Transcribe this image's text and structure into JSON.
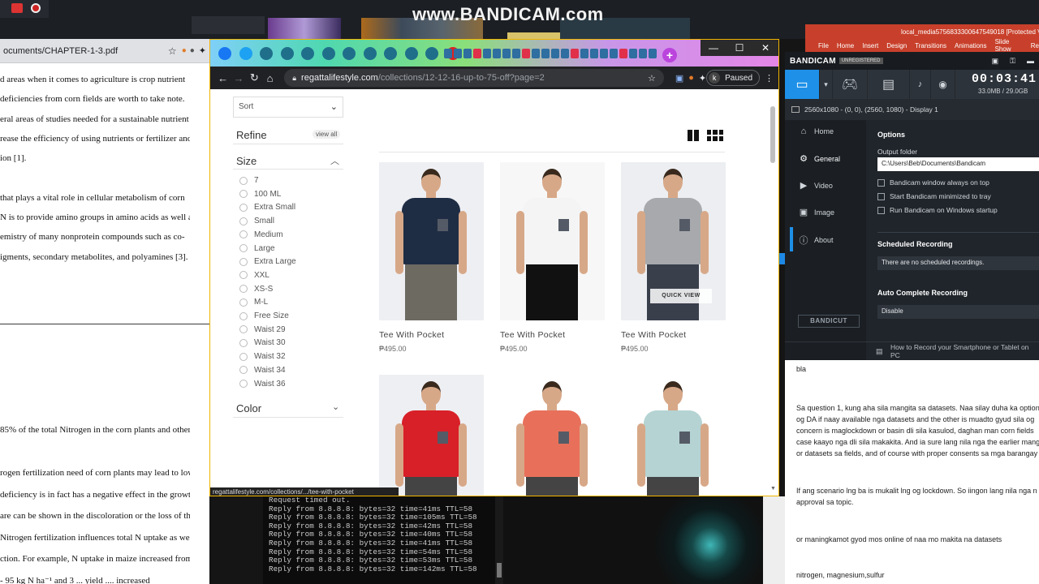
{
  "watermark": "www.BANDICAM.com",
  "pdf": {
    "tab_title": "ocuments/CHAPTER-1-3.pdf",
    "lines_top": [
      "d areas when it comes to agriculture is crop nutrient",
      "deficiencies from corn fields are worth to take note.",
      "eral areas of studies needed for a sustainable nutrient",
      "rease the efficiency of using nutrients or fertilizer and",
      "ion [1].",
      "",
      "that plays a vital role in cellular metabolism of corn",
      "N is to provide amino groups in amino acids as well as",
      "emistry of many nonprotein compounds such as co-",
      "igments, secondary metabolites, and polyamines [3]."
    ],
    "lines_bottom": [
      "85% of the total Nitrogen in the corn plants and other",
      "",
      "rogen fertilization need of corn plants may lead to low",
      "deficiency is in fact has a negative effect in the growth",
      "are can be shown in the discoloration or the loss of the",
      "Nitrogen fertilization influences total N uptake as well",
      "ction. For example, N uptake in maize increased from",
      "- 95 kg N ha⁻¹ and 3 ... yield .... increased"
    ]
  },
  "browser": {
    "url_domain": "regattalifestyle.com",
    "url_path": "/collections/12-12-16-up-to-75-off?page=2",
    "profile_initial": "k",
    "paused_label": "Paused",
    "status_url": "regattalifestyle.com/collections/.../tee-with-pocket",
    "window_controls": [
      "—",
      "☐",
      "✕"
    ]
  },
  "sidebar": {
    "sort_label": "Sort",
    "refine_label": "Refine",
    "view_all_label": "view all",
    "size_label": "Size",
    "size_options": [
      "7",
      "100 ML",
      "Extra Small",
      "Small",
      "Medium",
      "Large",
      "Extra Large",
      "XXL",
      "XS-S",
      "M-L",
      "Free Size",
      "Waist 29",
      "Waist 30",
      "Waist 32",
      "Waist 34",
      "Waist 36"
    ],
    "color_label": "Color"
  },
  "products": [
    {
      "name": "Tee With Pocket",
      "price": "₱495.00",
      "shirt": "#1f2d44",
      "pants": "#6d6a62",
      "bg": "#eeeff3"
    },
    {
      "name": "Tee With Pocket",
      "price": "₱495.00",
      "shirt": "#f4f4f4",
      "pants": "#111111",
      "bg": "#f7f7f7"
    },
    {
      "name": "Tee With Pocket",
      "price": "₱495.00",
      "shirt": "#a7a9ac",
      "pants": "#3a3f4c",
      "bg": "#eceef1",
      "quick_view": "QUICK VIEW"
    },
    {
      "name": "",
      "price": "",
      "shirt": "#d82029",
      "pants": "#444",
      "bg": "#eeeff3"
    },
    {
      "name": "",
      "price": "",
      "shirt": "#e8705a",
      "pants": "#444",
      "bg": "#ffffff"
    },
    {
      "name": "",
      "price": "",
      "shirt": "#b5d3d3",
      "pants": "#444",
      "bg": "#ffffff"
    }
  ],
  "terminal": {
    "lines": [
      "Request timed out.",
      "Reply from 8.8.8.8: bytes=32 time=41ms TTL=58",
      "Reply from 8.8.8.8: bytes=32 time=105ms TTL=58",
      "Reply from 8.8.8.8: bytes=32 time=42ms TTL=58",
      "Reply from 8.8.8.8: bytes=32 time=40ms TTL=58",
      "Reply from 8.8.8.8: bytes=32 time=41ms TTL=58",
      "Reply from 8.8.8.8: bytes=32 time=54ms TTL=58",
      "Reply from 8.8.8.8: bytes=32 time=53ms TTL=58",
      "Reply from 8.8.8.8: bytes=32 time=142ms TTL=58"
    ]
  },
  "bandicam": {
    "logo": "BANDICAM",
    "badge": "UNREGISTERED",
    "timer": "00:03:41",
    "size": "33.0MB / 29.0GB",
    "display": "2560x1080 - (0, 0), (2560, 1080) - Display 1",
    "nav": [
      "Home",
      "General",
      "Video",
      "Image",
      "About"
    ],
    "options_label": "Options",
    "output_folder_label": "Output folder",
    "output_folder": "C:\\Users\\Beb\\Documents\\Bandicam",
    "checks": [
      "Bandicam window always on top",
      "Start Bandicam minimized to tray",
      "Run Bandicam on Windows startup"
    ],
    "scheduled_label": "Scheduled Recording",
    "scheduled_text": "There are no scheduled recordings.",
    "auto_label": "Auto Complete Recording",
    "auto_value": "Disable",
    "bandicut": "BANDICUT",
    "footer": "How to Record your Smartphone or Tablet on PC"
  },
  "ppt": {
    "title": "local_media5756833300647549018 [Protected Vi",
    "menu": [
      "File",
      "Home",
      "Insert",
      "Design",
      "Transitions",
      "Animations",
      "Slide Show",
      "Re"
    ]
  },
  "doc": {
    "lines": [
      "bla",
      "Sa question 1, kung aha sila mangita sa datasets. Naa silay duha ka option",
      "og DA if naay available nga datasets and the other is muadto gyud sila og",
      "concern is maglockdown or basin dli sila kasulod, daghan man corn fields",
      "case kaayo nga dli sila makakita. And ia sure lang nila nga the earlier mangi",
      "or datasets sa fields, and of course with proper consents sa mga barangay",
      "If ang scenario lng ba is mukalit lng og lockdown. So iingon lang nila nga n",
      "approval sa topic.",
      "or maningkamot gyod mos online of naa mo makita na datasets",
      "nitrogen, magnesium,sulfur"
    ]
  }
}
